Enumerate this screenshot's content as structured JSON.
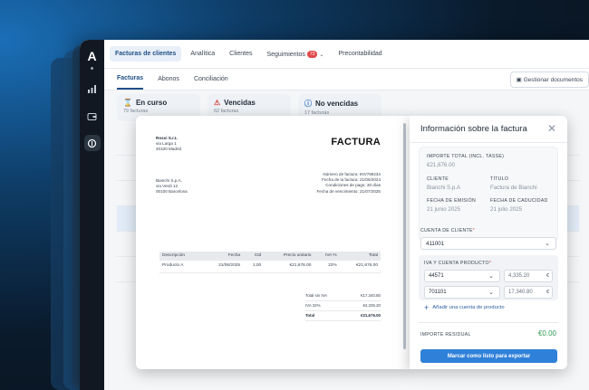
{
  "nav": {
    "tabs": [
      "Facturas de clientes",
      "Analítica",
      "Clientes",
      "Seguimientos",
      "Precontabilidad"
    ],
    "seguimientos_badge": "73"
  },
  "subnav": {
    "tabs": [
      "Facturas",
      "Abonos",
      "Conciliación"
    ],
    "manage_label": "Gestionar documentos"
  },
  "cards": [
    {
      "title": "En curso",
      "sub": "79 facturas"
    },
    {
      "title": "Vencidas",
      "sub": "62 facturas"
    },
    {
      "title": "No vencidas",
      "sub": "17 facturas"
    }
  ],
  "invoice": {
    "title": "FACTURA",
    "from": [
      "Rossi S.r.L",
      "via Larga 1",
      "20100 Madrid"
    ],
    "to": [
      "Bianchi S.p.A.",
      "via Verdi 12",
      "00100 Barcelona"
    ],
    "meta": [
      "Número de factura: INV789234",
      "Fecha de la factura: 21/06/2024",
      "Condiciones de pago: 30 días",
      "Fecha de vencimiento: 21/07/2025"
    ],
    "columns": [
      "Descripción",
      "Fecha",
      "Ctd",
      "Precio unitario",
      "IVA %",
      "Total"
    ],
    "rows": [
      [
        "Producto A",
        "21/06/2025",
        "1,00",
        "€21,676.00",
        "22%",
        "€21,676.00"
      ]
    ],
    "totals": [
      {
        "label": "Total sin IVA",
        "value": "€17,340.80"
      },
      {
        "label": "IVA 22%",
        "value": "€4,335.20"
      },
      {
        "label": "Total",
        "value": "€21,676.00"
      }
    ]
  },
  "panel": {
    "title": "Información sobre la factura",
    "importe_label": "IMPORTE TOTAL (INCL. TASSE)",
    "importe_value": "€21,676.00",
    "cliente_label": "CLIENTE",
    "cliente_value": "Bianchi S.p.A",
    "titulo_label": "TÍTULO",
    "titulo_value": "Factura de Bianchi",
    "emision_label": "FECHA DE EMISIÓN",
    "emision_value": "21 junio 2025",
    "caducidad_label": "FECHA DE CADUCIDAD",
    "caducidad_value": "21 julio 2025",
    "cuenta_cliente_label": "CUENTA DE CLIENTE",
    "cuenta_cliente_value": "411001",
    "iva_label": "IVA Y CUENTA PRODUCTO",
    "iva_rows": [
      {
        "account": "44571",
        "amount": "4,335.20",
        "currency": "€"
      },
      {
        "account": "701101",
        "amount": "17,340.80",
        "currency": "€"
      }
    ],
    "add_label": "Añadir una cuenta de producto",
    "residual_label": "IMPORTE RESIDUAL",
    "residual_value": "€0.00",
    "cta_label": "Marcar como listo para exportar"
  }
}
